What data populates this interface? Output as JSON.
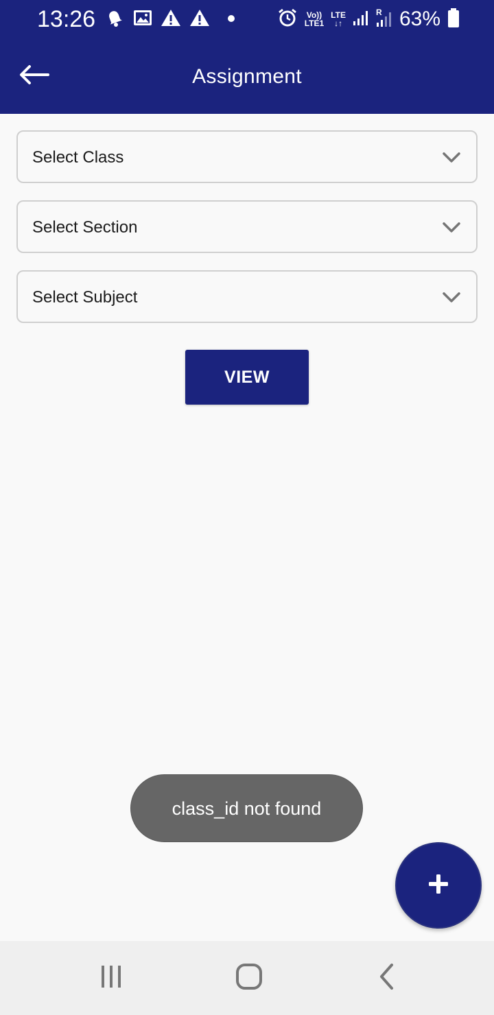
{
  "status_bar": {
    "time": "13:26",
    "battery_percent": "63%",
    "volte_label_top": "Vo))",
    "volte_label_bottom": "LTE1",
    "lte_label": "LTE",
    "roaming_label": "R",
    "icons": [
      "bell-icon",
      "image-icon",
      "warning-icon",
      "warning-icon",
      "dot-icon",
      "alarm-icon",
      "volte-icon",
      "lte-icon",
      "signal-icon",
      "signal-roaming-icon",
      "battery-icon"
    ]
  },
  "app_bar": {
    "title": "Assignment",
    "back_icon": "arrow-left-icon"
  },
  "form": {
    "class_select": {
      "placeholder": "Select Class"
    },
    "section_select": {
      "placeholder": "Select Section"
    },
    "subject_select": {
      "placeholder": "Select Subject"
    },
    "view_button_label": "VIEW"
  },
  "toast": {
    "message": "class_id not found"
  },
  "fab": {
    "icon": "plus-icon"
  },
  "nav_bar": {
    "icons": [
      "recent-apps-icon",
      "home-icon",
      "back-icon"
    ]
  },
  "colors": {
    "primary": "#1b237e",
    "background": "#f9f9f9",
    "toast_bg": "#666666",
    "navbar_bg": "#efefef",
    "border": "#cfcfcf"
  }
}
